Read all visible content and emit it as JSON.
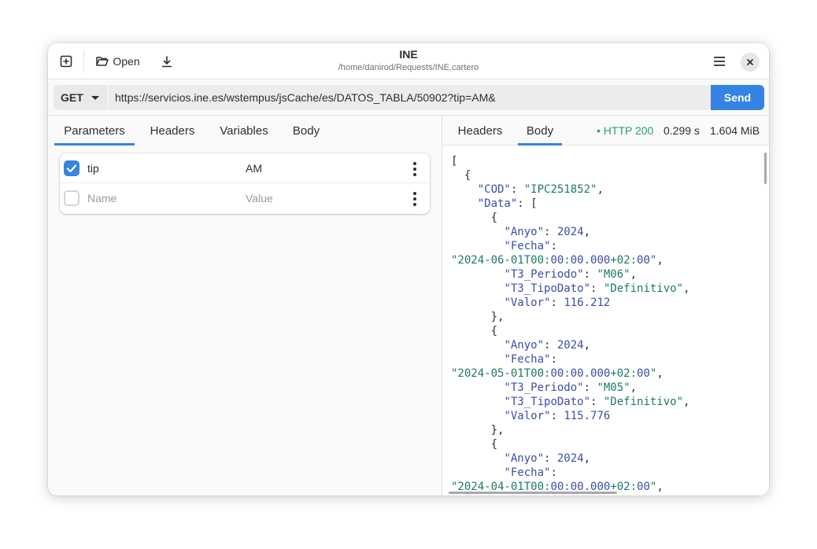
{
  "header": {
    "new_icon": "new-tab-icon",
    "open_label": "Open",
    "open_icon": "folder-open-icon",
    "save_icon": "download-icon",
    "title": "INE",
    "subtitle": "/home/danirod/Requests/INE.cartero",
    "menu_icon": "hamburger-menu-icon",
    "close_icon": "close-icon"
  },
  "request": {
    "method": "GET",
    "url": "https://servicios.ine.es/wstempus/jsCache/es/DATOS_TABLA/50902?tip=AM&",
    "send_label": "Send"
  },
  "request_tabs": [
    "Parameters",
    "Headers",
    "Variables",
    "Body"
  ],
  "active_request_tab": "Parameters",
  "params": [
    {
      "enabled": true,
      "name": "tip",
      "value": "AM"
    }
  ],
  "new_param": {
    "name_placeholder": "Name",
    "value_placeholder": "Value"
  },
  "response_tabs": [
    "Headers",
    "Body"
  ],
  "active_response_tab": "Body",
  "response_status": {
    "status": "• HTTP 200",
    "time": "0.299 s",
    "size": "1.604 MiB",
    "status_color": "#26a269"
  },
  "colors": {
    "accent": "#3584e4",
    "json_key": "#3a4fa6",
    "json_string": "#1c7a6a"
  },
  "response_body_lines": [
    "[",
    "  {",
    "    \"COD\": \"IPC251852\",",
    "    \"Data\": [",
    "      {",
    "        \"Anyo\": 2024,",
    "        \"Fecha\":",
    "\"2024-06-01T00:00:00.000+02:00\",",
    "        \"T3_Periodo\": \"M06\",",
    "        \"T3_TipoDato\": \"Definitivo\",",
    "        \"Valor\": 116.212",
    "      },",
    "      {",
    "        \"Anyo\": 2024,",
    "        \"Fecha\":",
    "\"2024-05-01T00:00:00.000+02:00\",",
    "        \"T3_Periodo\": \"M05\",",
    "        \"T3_TipoDato\": \"Definitivo\",",
    "        \"Valor\": 115.776",
    "      },",
    "      {",
    "        \"Anyo\": 2024,",
    "        \"Fecha\":",
    "\"2024-04-01T00:00:00.000+02:00\","
  ]
}
